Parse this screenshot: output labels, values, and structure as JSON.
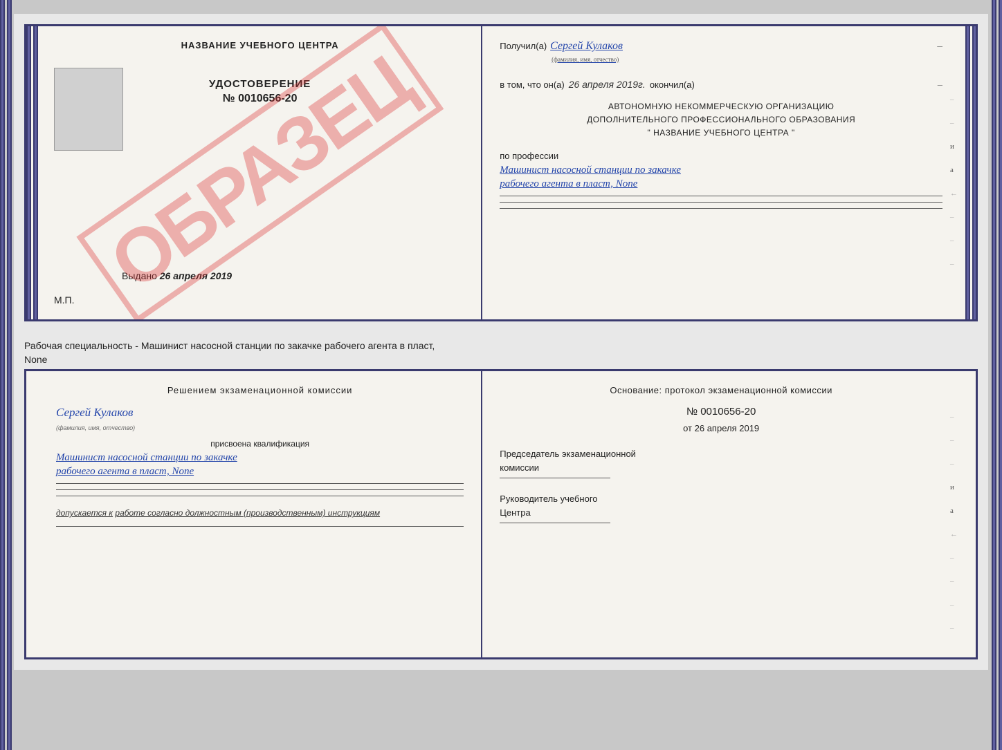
{
  "topDoc": {
    "left": {
      "centerTitle": "НАЗВАНИЕ УЧЕБНОГО ЦЕНТРА",
      "watermark": "ОБРАЗЕЦ",
      "udostoverenie": "УДОСТОВЕРЕНИЕ",
      "number": "№ 0010656-20",
      "vydano": "Выдано",
      "vydanoDate": "26 апреля 2019",
      "mp": "М.П."
    },
    "right": {
      "poluchilLabel": "Получил(а)",
      "poluchilName": "Сергей Кулаков",
      "poluchilSubtitle": "(фамилия, имя, отчество)",
      "vtomLabel": "в том, что он(а)",
      "vtomDate": "26 апреля 2019г.",
      "okonchill": "окончил(а)",
      "org1": "АВТОНОМНУЮ НЕКОММЕРЧЕСКУЮ ОРГАНИЗАЦИЮ",
      "org2": "ДОПОЛНИТЕЛЬНОГО ПРОФЕССИОНАЛЬНОГО ОБРАЗОВАНИЯ",
      "org3": "\"   НАЗВАНИЕ УЧЕБНОГО ЦЕНТРА   \"",
      "poProfessii": "по профессии",
      "profLine1": "Машинист насосной станции по закачке",
      "profLine2": "рабочего агента в пласт, None"
    }
  },
  "separator": {
    "text1": "Рабочая специальность - Машинист насосной станции по закачке рабочего агента в пласт,",
    "text2": "None"
  },
  "bottomDoc": {
    "left": {
      "resheniemTitle": "Решением экзаменационной комиссии",
      "name": "Сергей Кулаков",
      "nameSubtitle": "(фамилия, имя, отчество)",
      "prisvoena": "присвоена квалификация",
      "profLine1": "Машинист насосной станции по закачке",
      "profLine2": "рабочего агента в пласт, None",
      "dopuskaetsya": "допускается к",
      "dopuskaetsyaWork": "работе согласно должностным (производственным) инструкциям"
    },
    "right": {
      "osnovanie": "Основание: протокол экзаменационной комиссии",
      "number": "№ 0010656-20",
      "ot": "от",
      "date": "26 апреля 2019",
      "predsedatel": "Председатель экзаменационной",
      "komissii": "комиссии",
      "rukovoditel1": "Руководитель учебного",
      "rukovoditel2": "Центра"
    }
  }
}
